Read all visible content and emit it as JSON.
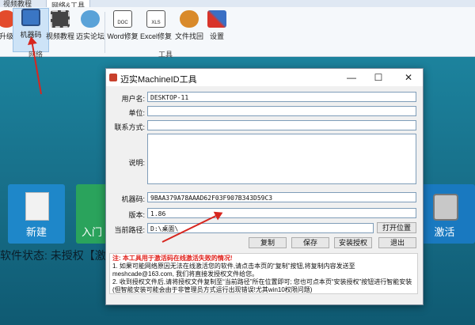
{
  "ribbon": {
    "tabs": [
      {
        "label": "视频教程"
      },
      {
        "label": "网络&工具"
      }
    ],
    "buttons": [
      {
        "label": "升级"
      },
      {
        "label": "机器码"
      },
      {
        "label": "视频教程"
      },
      {
        "label": "迈实论坛"
      },
      {
        "label": "Word修复"
      },
      {
        "label": "Excel修复"
      },
      {
        "label": "文件找回"
      },
      {
        "label": "设置"
      }
    ],
    "groups": [
      {
        "label": "网络"
      },
      {
        "label": "工具"
      }
    ],
    "icon_labels": {
      "doc": "DOC",
      "xls": "XLS"
    }
  },
  "main": {
    "tiles": [
      {
        "label": "新建"
      },
      {
        "label": "入门"
      },
      {
        "label": "激活"
      }
    ],
    "status": "软件状态: 未授权【激活"
  },
  "dialog": {
    "title": "迈实MachineID工具",
    "labels": {
      "username": "用户名:",
      "company": "单位:",
      "contact": "联系方式:",
      "description": "说明:",
      "machine_code": "机器码:",
      "version": "版本:",
      "current_path": "当前路径:"
    },
    "values": {
      "username": "DESKTOP-11",
      "company": "",
      "contact": "",
      "description": "",
      "machine_code": "9BAA379A78AAAD62F03F907B343D59C3",
      "version": "1.86",
      "current_path": "D:\\桌面\\"
    },
    "buttons": {
      "open_location": "打开位置",
      "copy": "复制",
      "save": "保存",
      "install": "安装授权",
      "exit": "退出"
    },
    "notes": {
      "warning": "注: 本工具用于激活码在线激活失败的情况!",
      "line1": "1. 如果可能网络原因无法在线激活您的软件,请点击本页的“复制”按钮,将复制内容发送至meshcade@163.com, 我们将直接发授权文件给您。",
      "line2": "2. 收到授权文件后,请将授权文件复制至“当前路径”所在位置即可; 您也可点本页“安装授权”按钮进行智能安装(但智能安装可能会由于非管理员方式运行出现错误!尤其win10权限问题)"
    }
  },
  "colors": {
    "accent": "#d7261f",
    "background": "#1d86a0"
  }
}
